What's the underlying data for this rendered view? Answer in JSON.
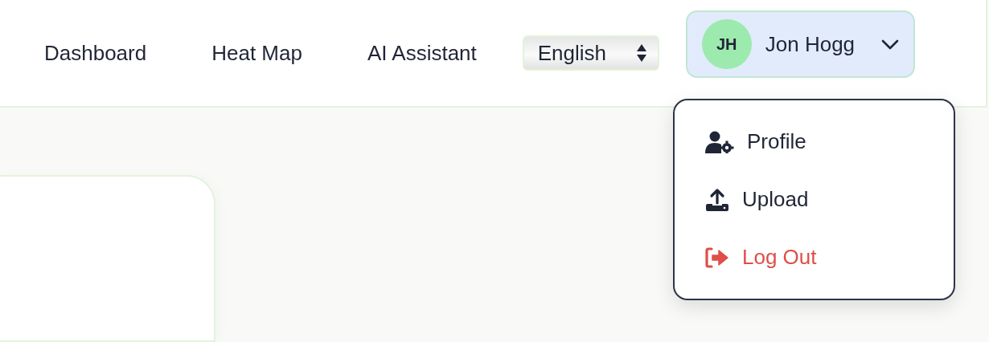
{
  "nav": [
    {
      "label": "Dashboard"
    },
    {
      "label": "Heat Map"
    },
    {
      "label": "AI Assistant"
    }
  ],
  "language_select": {
    "value": "English"
  },
  "user": {
    "initials": "JH",
    "name": "Jon Hogg",
    "expanded": true
  },
  "user_menu": [
    {
      "label": "Profile",
      "kind": "normal"
    },
    {
      "label": "Upload",
      "kind": "normal"
    },
    {
      "label": "Log Out",
      "kind": "danger"
    }
  ]
}
